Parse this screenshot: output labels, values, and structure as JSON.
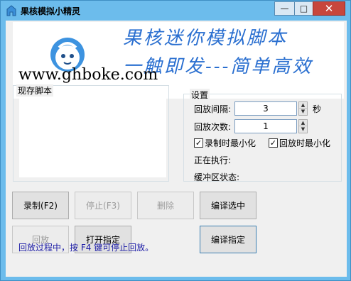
{
  "window": {
    "title": "果核模拟小精灵",
    "minimize": "—",
    "maximize": "□",
    "close": "✕"
  },
  "banner": {
    "line1": "果核迷你模拟脚本",
    "line2": "一触即发---简单高效",
    "url": "www.ghboke.com"
  },
  "scripts": {
    "group_label": "现存脚本",
    "items": []
  },
  "settings": {
    "group_label": "设置",
    "interval_label": "回放间隔:",
    "interval_value": "3",
    "interval_unit": "秒",
    "count_label": "回放次数:",
    "count_value": "1",
    "minimize_on_record": {
      "label": "录制时最小化",
      "checked": true
    },
    "minimize_on_playback": {
      "label": "回放时最小化",
      "checked": true
    },
    "executing_label": "正在执行:",
    "buffer_label": "缓冲区状态:"
  },
  "buttons": {
    "record": "录制(F2)",
    "stop": "停止(F3)",
    "delete": "删除",
    "compile_selected": "编译选中",
    "playback": "回放",
    "open_specified": "打开指定",
    "compile_specified": "编译指定"
  },
  "status": "回放过程中，按 F4 键可停止回放。",
  "colors": {
    "banner_text": "#2a6fd0",
    "status_text": "#1a1aa6",
    "window_frame": "#6cbcec",
    "close_button": "#c7463c"
  },
  "icons": [
    "app-icon",
    "ghboke-logo",
    "minimize-icon",
    "maximize-icon",
    "close-icon",
    "spin-up-icon",
    "spin-down-icon",
    "checkbox-checked-icon"
  ]
}
